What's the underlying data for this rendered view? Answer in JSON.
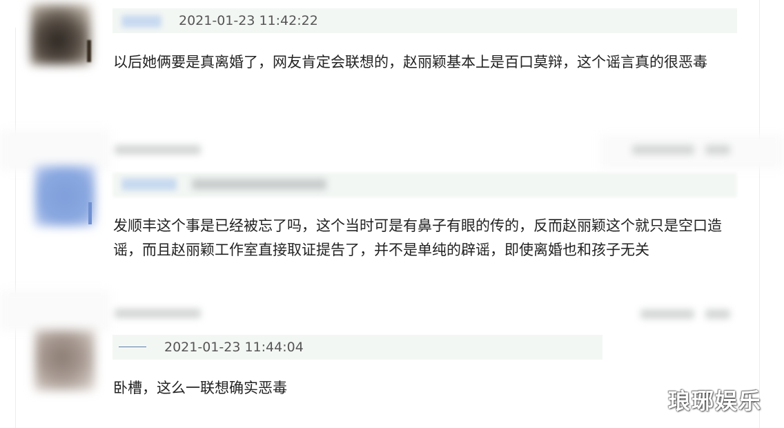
{
  "comments": [
    {
      "timestamp": "2021-01-23 11:42:22",
      "text": "以后她俩要是真离婚了，网友肯定会联想的，赵丽颖基本上是百口莫辩，这个谣言真的很恶毒"
    },
    {
      "timestamp": "",
      "text": "发顺丰这个事是已经被忘了吗，这个当时可是有鼻子有眼的传的，反而赵丽颖这个就只是空口造谣，而且赵丽颖工作室直接取证提告了，并不是单纯的辟谣，即使离婚也和孩子无关"
    },
    {
      "timestamp": "2021-01-23 11:44:04",
      "text": "卧槽，这么一联想确实恶毒"
    }
  ],
  "watermark": "琅琊娱乐",
  "colors": {
    "meta_bar": "#f3f7f4",
    "text": "#222222",
    "timestamp": "#555555"
  }
}
